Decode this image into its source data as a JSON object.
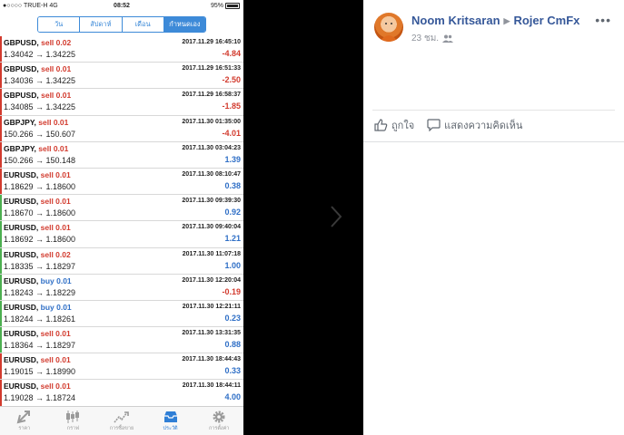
{
  "status_bar": {
    "carrier": "●○○○○ TRUE-H  4G",
    "time": "08:52",
    "battery": "95%"
  },
  "segments": [
    "วัน",
    "สัปดาห์",
    "เดือน",
    "กำหนดเอง"
  ],
  "trades": [
    {
      "pair": "GBPUSD,",
      "side": "sell",
      "side_label": "sell 0.02",
      "date": "2017.11.29 16:45:10",
      "prices": "1.34042 → 1.34225",
      "profit": "-4.84",
      "edge": "#d23b2e"
    },
    {
      "pair": "GBPUSD,",
      "side": "sell",
      "side_label": "sell 0.01",
      "date": "2017.11.29 16:51:33",
      "prices": "1.34036 → 1.34225",
      "profit": "-2.50",
      "edge": "#d23b2e"
    },
    {
      "pair": "GBPUSD,",
      "side": "sell",
      "side_label": "sell 0.01",
      "date": "2017.11.29 16:58:37",
      "prices": "1.34085 → 1.34225",
      "profit": "-1.85",
      "edge": "#d23b2e"
    },
    {
      "pair": "GBPJPY,",
      "side": "sell",
      "side_label": "sell 0.01",
      "date": "2017.11.30 01:35:00",
      "prices": "150.266 → 150.607",
      "profit": "-4.01",
      "edge": "#d23b2e"
    },
    {
      "pair": "GBPJPY,",
      "side": "sell",
      "side_label": "sell 0.01",
      "date": "2017.11.30 03:04:23",
      "prices": "150.266 → 150.148",
      "profit": "1.39",
      "edge": "#d23b2e"
    },
    {
      "pair": "EURUSD,",
      "side": "sell",
      "side_label": "sell 0.01",
      "date": "2017.11.30 08:10:47",
      "prices": "1.18629 → 1.18600",
      "profit": "0.38",
      "edge": "#d23b2e"
    },
    {
      "pair": "EURUSD,",
      "side": "sell",
      "side_label": "sell 0.01",
      "date": "2017.11.30 09:39:30",
      "prices": "1.18670 → 1.18600",
      "profit": "0.92",
      "edge": "#4caf50"
    },
    {
      "pair": "EURUSD,",
      "side": "sell",
      "side_label": "sell 0.01",
      "date": "2017.11.30 09:40:04",
      "prices": "1.18692 → 1.18600",
      "profit": "1.21",
      "edge": "#4caf50"
    },
    {
      "pair": "EURUSD,",
      "side": "sell",
      "side_label": "sell 0.02",
      "date": "2017.11.30 11:07:18",
      "prices": "1.18335 → 1.18297",
      "profit": "1.00",
      "edge": "#4caf50"
    },
    {
      "pair": "EURUSD,",
      "side": "buy",
      "side_label": "buy 0.01",
      "date": "2017.11.30 12:20:04",
      "prices": "1.18243 → 1.18229",
      "profit": "-0.19",
      "edge": "#4caf50"
    },
    {
      "pair": "EURUSD,",
      "side": "buy",
      "side_label": "buy 0.01",
      "date": "2017.11.30 12:21:11",
      "prices": "1.18244 → 1.18261",
      "profit": "0.23",
      "edge": "#4caf50"
    },
    {
      "pair": "EURUSD,",
      "side": "sell",
      "side_label": "sell 0.01",
      "date": "2017.11.30 13:31:35",
      "prices": "1.18364 → 1.18297",
      "profit": "0.88",
      "edge": "#4caf50"
    },
    {
      "pair": "EURUSD,",
      "side": "sell",
      "side_label": "sell 0.01",
      "date": "2017.11.30 18:44:43",
      "prices": "1.19015 → 1.18990",
      "profit": "0.33",
      "edge": "#d23b2e"
    },
    {
      "pair": "EURUSD,",
      "side": "sell",
      "side_label": "sell 0.01",
      "date": "2017.11.30 18:44:11",
      "prices": "1.19028 → 1.18724",
      "profit": "4.00",
      "edge": "#d23b2e"
    }
  ],
  "tabbar": [
    {
      "label": "ราคา",
      "icon": "quotes-icon",
      "active": false
    },
    {
      "label": "กราฟ",
      "icon": "chart-icon",
      "active": false
    },
    {
      "label": "การซื้อขาย",
      "icon": "trade-icon",
      "active": false
    },
    {
      "label": "ประวัติ",
      "icon": "history-icon",
      "active": true
    },
    {
      "label": "การตั้งค่า",
      "icon": "settings-icon",
      "active": false
    }
  ],
  "post": {
    "author": "Noom Kritsaran",
    "target": "Rojer CmFx",
    "time": "23 ชม.",
    "like_label": "ถูกใจ",
    "comment_label": "แสดงความคิดเห็น"
  },
  "colors": {
    "accent": "#3d8ad8",
    "sell": "#d23b2e",
    "buy": "#2f6fc6",
    "fb_link": "#365899"
  }
}
